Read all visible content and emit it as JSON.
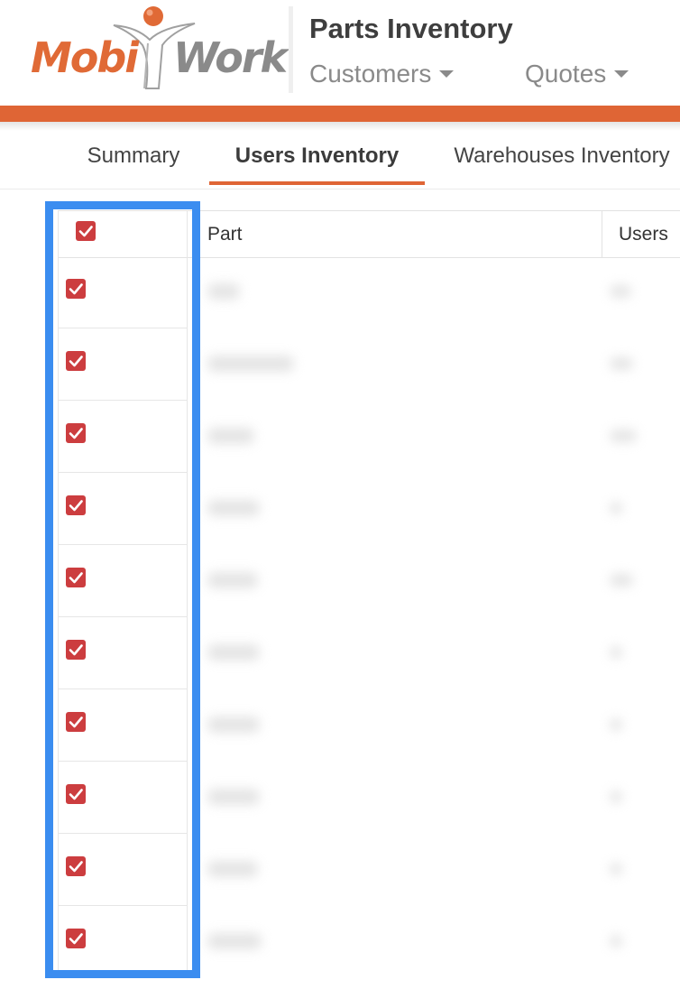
{
  "brand": {
    "logo_text_left": "Mobi",
    "logo_text_right": "Work",
    "brand_orange": "#df6535",
    "brand_gray": "#8a8a8a"
  },
  "header": {
    "title": "Parts Inventory",
    "menus": [
      {
        "label": "Customers",
        "icon": "caret-down-icon"
      },
      {
        "label": "Quotes",
        "icon": "caret-down-icon"
      }
    ]
  },
  "tabs": [
    {
      "label": "Summary",
      "active": false
    },
    {
      "label": "Users Inventory",
      "active": true
    },
    {
      "label": "Warehouses Inventory",
      "active": false
    }
  ],
  "grid": {
    "columns": [
      "Part",
      "Users"
    ],
    "select_all_checked": true,
    "rows": [
      {
        "checked": true
      },
      {
        "checked": true
      },
      {
        "checked": true
      },
      {
        "checked": true
      },
      {
        "checked": true
      },
      {
        "checked": true
      },
      {
        "checked": true
      },
      {
        "checked": true
      },
      {
        "checked": true
      },
      {
        "checked": true
      }
    ]
  },
  "colors": {
    "checkbox": "#cc3d3f",
    "highlight": "#3b8df0",
    "active_tab_underline": "#df6535"
  }
}
